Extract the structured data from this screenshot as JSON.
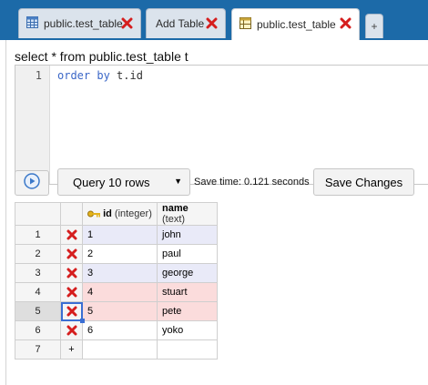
{
  "tabs": [
    {
      "label": "public.test_table",
      "icon": "table-grid-icon",
      "active": false
    },
    {
      "label": "Add Table",
      "icon": "",
      "active": false
    },
    {
      "label": "public.test_table",
      "icon": "table-edit-icon",
      "active": true
    },
    {
      "label": "+",
      "icon": "",
      "active": false
    }
  ],
  "editor": {
    "query_line": "select * from public.test_table t",
    "line_number": "1",
    "code_keyword1": "order",
    "code_keyword2": "by",
    "code_rest": "t.id"
  },
  "toolbar": {
    "run_icon": "play-icon",
    "query_select_value": "Query 10 rows",
    "save_time": "Save time: 0.121 seconds",
    "save_label": "Save Changes"
  },
  "grid": {
    "columns": [
      {
        "name": "id",
        "type": "(integer)",
        "icon": "primary-key-icon"
      },
      {
        "name": "name",
        "type": "(text)"
      }
    ],
    "rows": [
      {
        "num": "1",
        "id": "1",
        "name": "john",
        "state": "blue"
      },
      {
        "num": "2",
        "id": "2",
        "name": "paul",
        "state": "white"
      },
      {
        "num": "3",
        "id": "3",
        "name": "george",
        "state": "blue"
      },
      {
        "num": "4",
        "id": "4",
        "name": "stuart",
        "state": "red"
      },
      {
        "num": "5",
        "id": "5",
        "name": "pete",
        "state": "red"
      },
      {
        "num": "6",
        "id": "6",
        "name": "yoko",
        "state": "white"
      }
    ],
    "new_row": {
      "num": "7",
      "add": "+"
    }
  },
  "colors": {
    "tabbar": "#1c6aa8",
    "row_blue": "#e9eaf8",
    "row_red": "#fbdcdc",
    "delete_x": "#d51e1e",
    "selection": "#3a6ed3"
  }
}
